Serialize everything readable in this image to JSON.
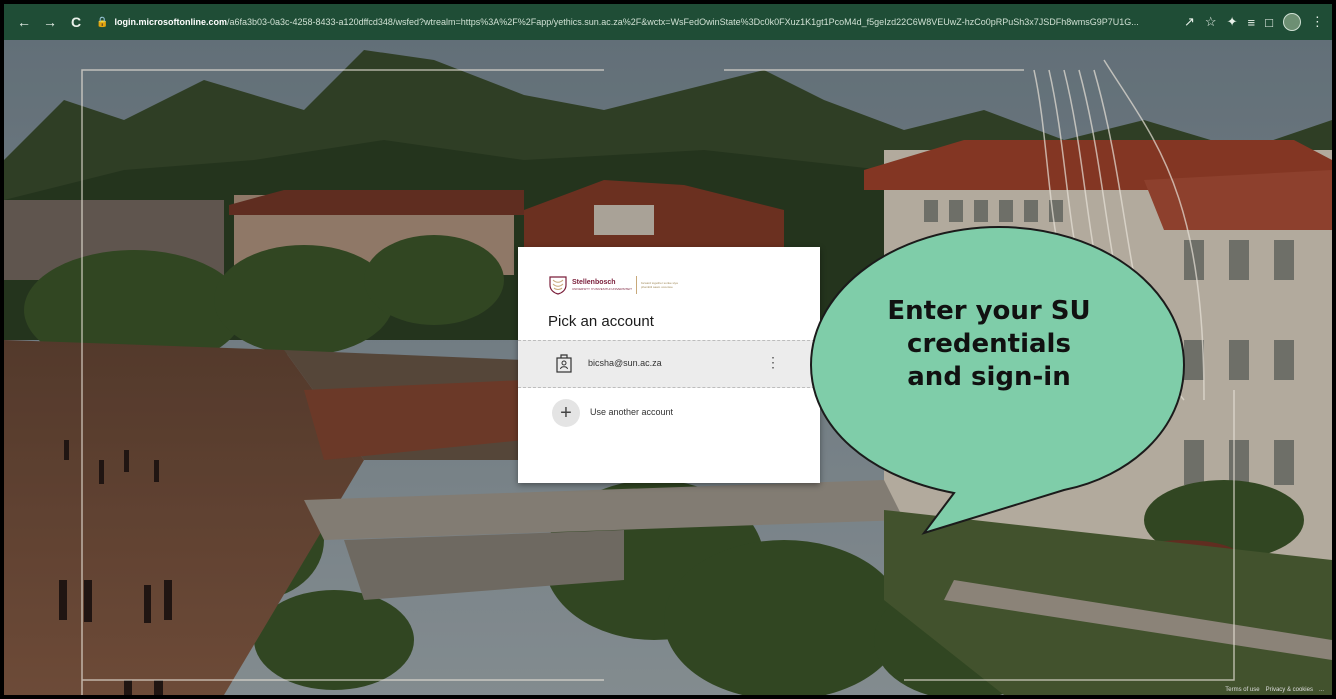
{
  "browser": {
    "back_icon": "←",
    "forward_icon": "→",
    "reload_icon": "C",
    "lock_icon": "🔒",
    "url_host": "login.microsoftonline.com",
    "url_rest": "/a6fa3b03-0a3c-4258-8433-a120dffcd348/wsfed?wtrealm=https%3A%2F%2Fapp/yethics.sun.ac.za%2F&wctx=WsFedOwinState%3Dc0k0FXuz1K1gt1PcoM4d_f5geIzd22C6W8VEUwZ-hzCo0pRPuSh3x7JSDFh8wmsG9P7U1G...",
    "icons": [
      "share-icon",
      "star-icon",
      "extensions-icon",
      "reading-list-icon",
      "window-icon",
      "profile-icon",
      "menu-icon"
    ]
  },
  "card": {
    "logo_name": "Stellenbosch",
    "logo_sub": "UNIVERSITY IYUNIVESITHI UNIVERSITEIT",
    "logo_sub2": "forward together sonke siya phambili saam vorentoe",
    "title": "Pick an account",
    "account_email": "bicsha@sun.ac.za",
    "kebab": "⋮",
    "plus": "+",
    "another_label": "Use another account"
  },
  "bubble": {
    "line1": "Enter your SU",
    "line2": "credentials",
    "line3": "and sign-in",
    "fill": "#7fcda9",
    "stroke": "#1b1b1b"
  },
  "footer": {
    "terms": "Terms of use",
    "privacy": "Privacy & cookies",
    "more": "..."
  },
  "colors": {
    "browser_bar": "#1f4d36",
    "card_bg": "#ffffff",
    "selected_row": "#ececec"
  }
}
